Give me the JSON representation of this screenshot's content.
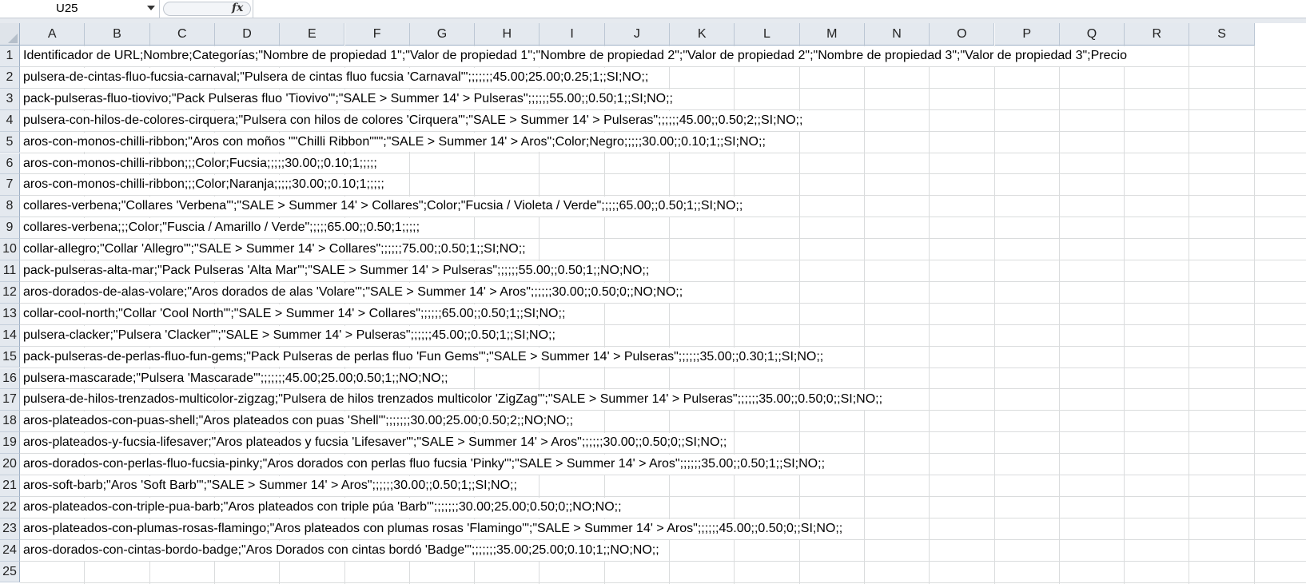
{
  "formula_bar": {
    "name_box": "U25",
    "fx_label": "fx",
    "formula": ""
  },
  "columns": [
    "A",
    "B",
    "C",
    "D",
    "E",
    "F",
    "G",
    "H",
    "I",
    "J",
    "K",
    "L",
    "M",
    "N",
    "O",
    "P",
    "Q",
    "R",
    "S"
  ],
  "rows": [
    {
      "num": "1",
      "text": "Identificador de URL;Nombre;Categorías;\"Nombre de propiedad 1\";\"Valor de propiedad 1\";\"Nombre de propiedad 2\";\"Valor de propiedad 2\";\"Nombre de propiedad 3\";\"Valor de propiedad 3\";Precio"
    },
    {
      "num": "2",
      "text": "pulsera-de-cintas-fluo-fucsia-carnaval;\"Pulsera de cintas fluo fucsia 'Carnaval'\";;;;;;;45.00;25.00;0.25;1;;SI;NO;;"
    },
    {
      "num": "3",
      "text": "pack-pulseras-fluo-tiovivo;\"Pack Pulseras fluo 'Tiovivo'\";\"SALE > Summer 14' > Pulseras\";;;;;;55.00;;0.50;1;;SI;NO;;"
    },
    {
      "num": "4",
      "text": "pulsera-con-hilos-de-colores-cirquera;\"Pulsera con hilos de colores 'Cirquera'\";\"SALE > Summer 14' > Pulseras\";;;;;;45.00;;0.50;2;;SI;NO;;"
    },
    {
      "num": "5",
      "text": "aros-con-monos-chilli-ribbon;\"Aros con moños \"\"Chilli Ribbon\"\"\";\"SALE > Summer 14' > Aros\";Color;Negro;;;;;30.00;;0.10;1;;SI;NO;;"
    },
    {
      "num": "6",
      "text": "aros-con-monos-chilli-ribbon;;;Color;Fucsia;;;;;30.00;;0.10;1;;;;;"
    },
    {
      "num": "7",
      "text": "aros-con-monos-chilli-ribbon;;;Color;Naranja;;;;;30.00;;0.10;1;;;;;"
    },
    {
      "num": "8",
      "text": "collares-verbena;\"Collares 'Verbena'\";\"SALE > Summer 14' > Collares\";Color;\"Fucsia / Violeta / Verde\";;;;;65.00;;0.50;1;;SI;NO;;"
    },
    {
      "num": "9",
      "text": "collares-verbena;;;Color;\"Fuscia / Amarillo / Verde\";;;;;65.00;;0.50;1;;;;;"
    },
    {
      "num": "10",
      "text": "collar-allegro;\"Collar 'Allegro'\";\"SALE > Summer 14' > Collares\";;;;;;75.00;;0.50;1;;SI;NO;;"
    },
    {
      "num": "11",
      "text": "pack-pulseras-alta-mar;\"Pack Pulseras 'Alta Mar'\";\"SALE > Summer 14' > Pulseras\";;;;;;55.00;;0.50;1;;NO;NO;;"
    },
    {
      "num": "12",
      "text": "aros-dorados-de-alas-volare;\"Aros dorados de alas 'Volare'\";\"SALE > Summer 14' > Aros\";;;;;;30.00;;0.50;0;;NO;NO;;"
    },
    {
      "num": "13",
      "text": "collar-cool-north;\"Collar 'Cool North'\";\"SALE > Summer 14' > Collares\";;;;;;65.00;;0.50;1;;SI;NO;;"
    },
    {
      "num": "14",
      "text": "pulsera-clacker;\"Pulsera 'Clacker'\";\"SALE > Summer 14' > Pulseras\";;;;;;45.00;;0.50;1;;SI;NO;;"
    },
    {
      "num": "15",
      "text": "pack-pulseras-de-perlas-fluo-fun-gems;\"Pack Pulseras de perlas fluo 'Fun Gems'\";\"SALE > Summer 14' > Pulseras\";;;;;;35.00;;0.30;1;;SI;NO;;"
    },
    {
      "num": "16",
      "text": "pulsera-mascarade;\"Pulsera 'Mascarade'\";;;;;;;45.00;25.00;0.50;1;;NO;NO;;"
    },
    {
      "num": "17",
      "text": "pulsera-de-hilos-trenzados-multicolor-zigzag;\"Pulsera de hilos trenzados multicolor 'ZigZag'\";\"SALE > Summer 14' > Pulseras\";;;;;;35.00;;0.50;0;;SI;NO;;"
    },
    {
      "num": "18",
      "text": "aros-plateados-con-puas-shell;\"Aros plateados con puas 'Shell'\";;;;;;;30.00;25.00;0.50;2;;NO;NO;;"
    },
    {
      "num": "19",
      "text": "aros-plateados-y-fucsia-lifesaver;\"Aros plateados y fucsia 'Lifesaver'\";\"SALE > Summer 14' > Aros\";;;;;;30.00;;0.50;0;;SI;NO;;"
    },
    {
      "num": "20",
      "text": "aros-dorados-con-perlas-fluo-fucsia-pinky;\"Aros dorados con perlas fluo fucsia 'Pinky'\";\"SALE > Summer 14' > Aros\";;;;;;35.00;;0.50;1;;SI;NO;;"
    },
    {
      "num": "21",
      "text": "aros-soft-barb;\"Aros 'Soft Barb'\";\"SALE > Summer 14' > Aros\";;;;;;30.00;;0.50;1;;SI;NO;;"
    },
    {
      "num": "22",
      "text": "aros-plateados-con-triple-pua-barb;\"Aros plateados con triple púa 'Barb'\";;;;;;;30.00;25.00;0.50;0;;NO;NO;;"
    },
    {
      "num": "23",
      "text": "aros-plateados-con-plumas-rosas-flamingo;\"Aros plateados con plumas rosas 'Flamingo'\";\"SALE > Summer 14' > Aros\";;;;;;45.00;;0.50;0;;SI;NO;;"
    },
    {
      "num": "24",
      "text": "aros-dorados-con-cintas-bordo-badge;\"Aros Dorados con cintas bordó 'Badge'\";;;;;;;35.00;25.00;0.10;1;;NO;NO;;"
    },
    {
      "num": "25",
      "text": ""
    }
  ]
}
